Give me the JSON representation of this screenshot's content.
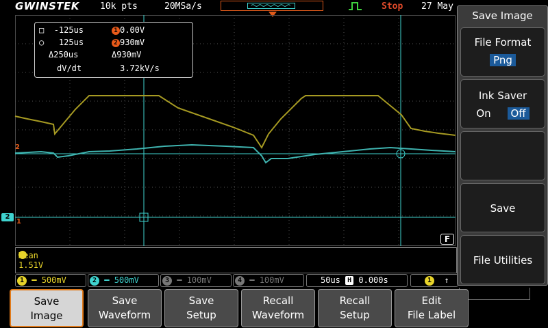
{
  "header": {
    "brand": "GWINSTEK",
    "record_length": "10k pts",
    "sample_rate": "20MSa/s",
    "run_state": "Stop",
    "date": "27 May"
  },
  "measurement": {
    "cursor1_time": "-125us",
    "cursor2_time": "125us",
    "delta_time": "Δ250us",
    "cursor1_volt": "0.00V",
    "cursor2_volt": "930mV",
    "delta_volt": "Δ930mV",
    "rate_label": "dV/dt",
    "rate_value": "3.72kV/s",
    "ch_badge": "1",
    "ch_badge2": "2"
  },
  "channel_markers": {
    "ch2_left": "2",
    "ch1_left": "1",
    "ch2_side": "2"
  },
  "mean": {
    "badge": "1",
    "text": "Mean 1.51V"
  },
  "channels": [
    {
      "num": "1",
      "scale": "500mV",
      "color": "#e8d42a",
      "active": true
    },
    {
      "num": "2",
      "scale": "500mV",
      "color": "#3fd3cf",
      "active": true
    },
    {
      "num": "3",
      "scale": "100mV",
      "color": "#777777",
      "active": false
    },
    {
      "num": "4",
      "scale": "100mV",
      "color": "#777777",
      "active": false
    }
  ],
  "timebase": {
    "scale": "50us",
    "hoffset": "0.000s",
    "h_icon": "H"
  },
  "trigger": {
    "source": "1"
  },
  "side_menu": {
    "title": "Save Image",
    "file_format_label": "File Format",
    "file_format_value": "Png",
    "ink_saver_label": "Ink Saver",
    "ink_on": "On",
    "ink_off": "Off",
    "save_label": "Save",
    "file_utilities_label": "File Utilities"
  },
  "softkeys": [
    {
      "line1": "Save",
      "line2": "Image",
      "active": true
    },
    {
      "line1": "Save",
      "line2": "Waveform",
      "active": false
    },
    {
      "line1": "Save",
      "line2": "Setup",
      "active": false
    },
    {
      "line1": "Recall",
      "line2": "Waveform",
      "active": false
    },
    {
      "line1": "Recall",
      "line2": "Setup",
      "active": false
    },
    {
      "line1": "Edit",
      "line2": "File Label",
      "active": false
    }
  ],
  "f_badge": "F",
  "colors": {
    "ch1": "#e8d42a",
    "ch1_trace": "#a69a22",
    "ch2": "#3fd3cf",
    "accent": "#e05a1a",
    "selected": "#1b5a9a"
  }
}
